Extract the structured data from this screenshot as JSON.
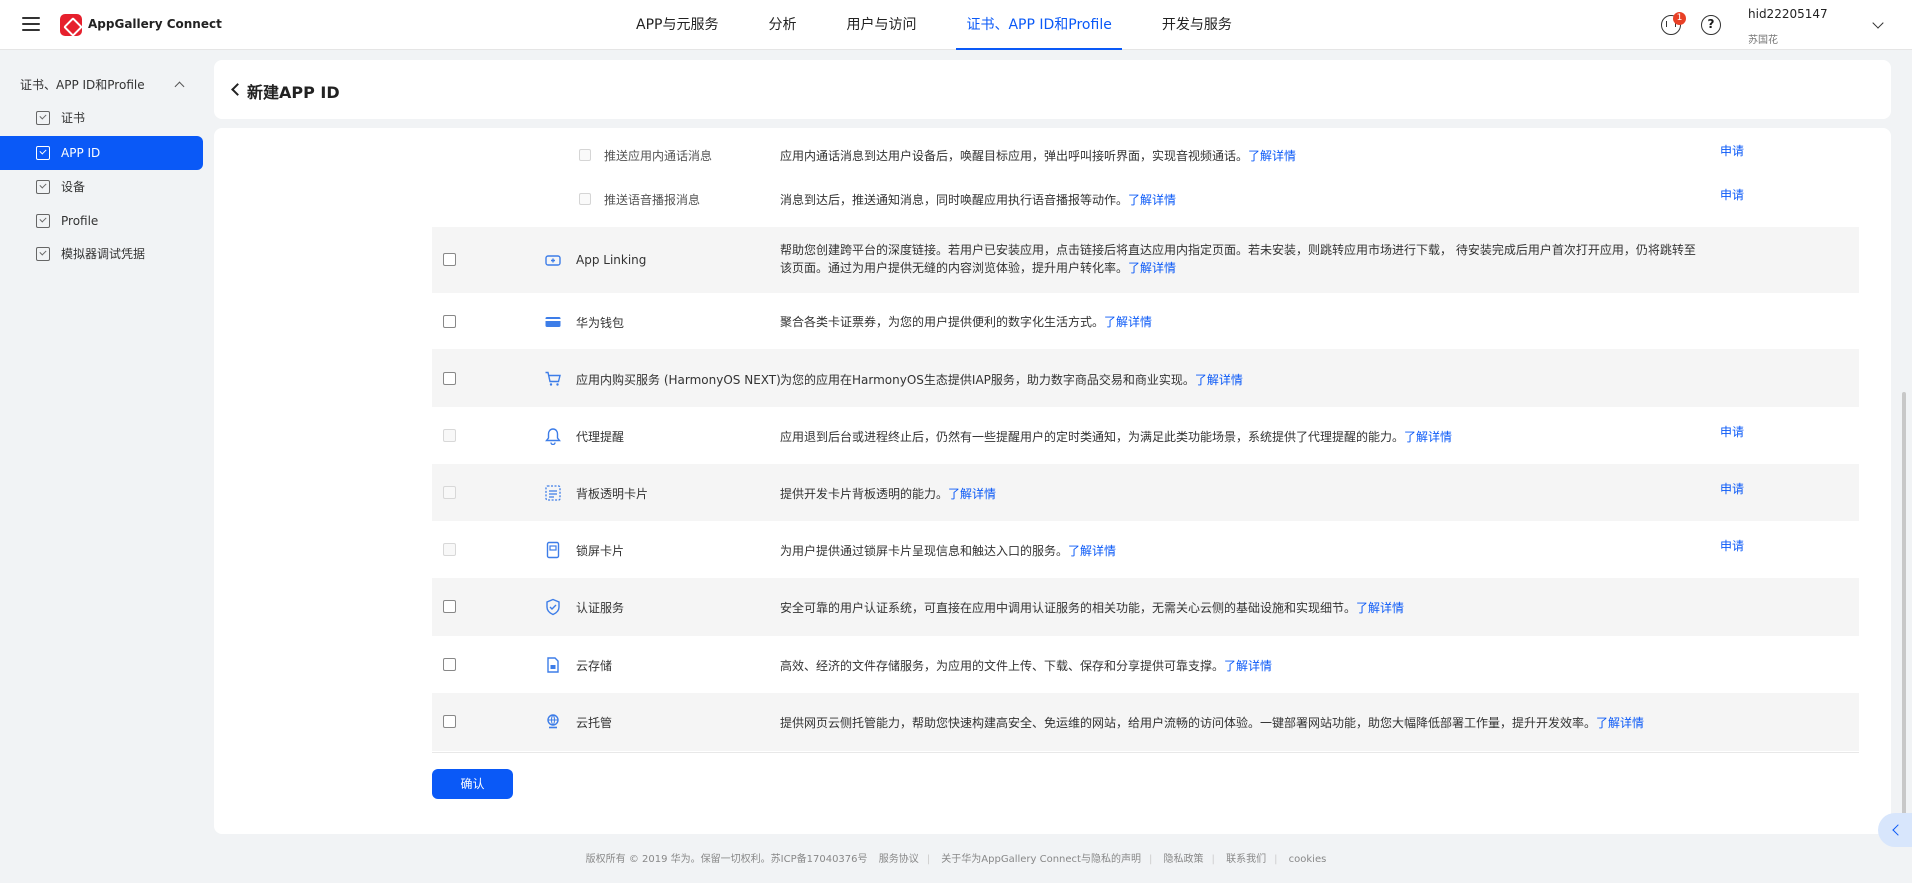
{
  "header": {
    "brand": "AppGallery Connect",
    "nav": [
      "APP与元服务",
      "分析",
      "用户与访问",
      "证书、APP ID和Profile",
      "开发与服务"
    ],
    "active_nav": 3,
    "notification_count": "1",
    "user_id": "hid22205147",
    "user_name": "苏国花"
  },
  "sidebar": {
    "group": "证书、APP ID和Profile",
    "items": [
      {
        "label": "证书"
      },
      {
        "label": "APP ID"
      },
      {
        "label": "设备"
      },
      {
        "label": "Profile"
      },
      {
        "label": "模拟器调试凭据"
      }
    ],
    "active": 1
  },
  "page": {
    "title": "新建APP ID"
  },
  "sub_permissions": [
    {
      "name": "推送应用内通话消息",
      "desc": "应用内通话消息到达用户设备后，唤醒目标应用，弹出呼叫接听界面，实现音视频通话。",
      "more": "了解详情",
      "apply": "申请"
    },
    {
      "name": "推送语音播报消息",
      "desc": "消息到达后，推送通知消息，同时唤醒应用执行语音播报等动作。",
      "more": "了解详情",
      "apply": "申请"
    }
  ],
  "services": [
    {
      "icon": "link-icon",
      "name": "App Linking",
      "desc": "帮助您创建跨平台的深度链接。若用户已安装应用，点击链接后将直达应用内指定页面。若未安装，则跳转应用市场进行下载， 待安装完成后用户首次打开应用，仍将跳转至该页面。通过为用户提供无缝的内容浏览体验，提升用户转化率。",
      "more": "了解详情",
      "apply": "",
      "disabled": false
    },
    {
      "icon": "wallet-icon",
      "name": "华为钱包",
      "desc": "聚合各类卡证票券，为您的用户提供便利的数字化生活方式。",
      "more": "了解详情",
      "apply": "",
      "disabled": false
    },
    {
      "icon": "cart-icon",
      "name": "应用内购买服务 (HarmonyOS NEXT)",
      "desc": "为您的应用在HarmonyOS生态提供IAP服务，助力数字商品交易和商业实现。",
      "more": "了解详情",
      "apply": "",
      "disabled": false
    },
    {
      "icon": "bell-reminder-icon",
      "name": "代理提醒",
      "desc": "应用退到后台或进程终止后，仍然有一些提醒用户的定时类通知，为满足此类功能场景，系统提供了代理提醒的能力。",
      "more": "了解详情",
      "apply": "申请",
      "disabled": true
    },
    {
      "icon": "transparent-card-icon",
      "name": "背板透明卡片",
      "desc": "提供开发卡片背板透明的能力。",
      "more": "了解详情",
      "apply": "申请",
      "disabled": true
    },
    {
      "icon": "lock-screen-card-icon",
      "name": "锁屏卡片",
      "desc": "为用户提供通过锁屏卡片呈现信息和触达入口的服务。",
      "more": "了解详情",
      "apply": "申请",
      "disabled": true
    },
    {
      "icon": "shield-check-icon",
      "name": "认证服务",
      "desc": "安全可靠的用户认证系统，可直接在应用中调用认证服务的相关功能，无需关心云侧的基础设施和实现细节。",
      "more": "了解详情",
      "apply": "",
      "disabled": false
    },
    {
      "icon": "cloud-storage-icon",
      "name": "云存储",
      "desc": "高效、经济的文件存储服务，为应用的文件上传、下载、保存和分享提供可靠支撑。",
      "more": "了解详情",
      "apply": "",
      "disabled": false
    },
    {
      "icon": "cloud-hosting-icon",
      "name": "云托管",
      "desc": "提供网页云侧托管能力，帮助您快速构建高安全、免运维的网站，给用户流畅的访问体验。一键部署网站功能，助您大幅降低部署工作量，提升开发效率。",
      "more": "了解详情",
      "apply": "",
      "disabled": false
    }
  ],
  "confirm_label": "确认",
  "footer": {
    "copyright": "版权所有 © 2019 华为。保留一切权利。苏ICP备17040376号",
    "links": [
      "服务协议",
      "关于华为AppGallery Connect与隐私的声明",
      "隐私政策",
      "联系我们",
      "cookies"
    ]
  },
  "colors": {
    "accent": "#0a59f7",
    "badge": "#e84026",
    "brand": "#e6202d"
  }
}
